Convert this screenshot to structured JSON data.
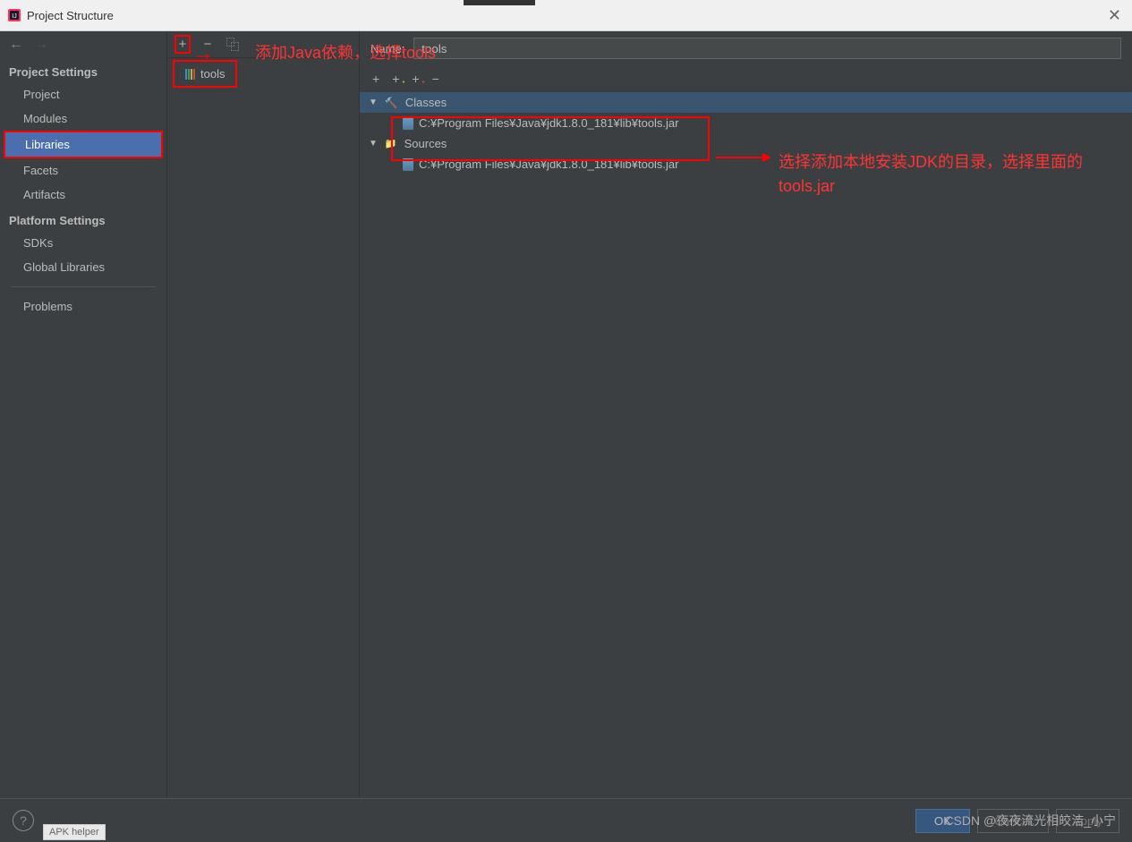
{
  "titlebar": {
    "title": "Project Structure"
  },
  "nav": {
    "back": "←",
    "forward": "→"
  },
  "sidebar": {
    "section1": "Project Settings",
    "items1": [
      "Project",
      "Modules",
      "Libraries",
      "Facets",
      "Artifacts"
    ],
    "section2": "Platform Settings",
    "items2": [
      "SDKs",
      "Global Libraries"
    ],
    "section3": "Problems"
  },
  "middle": {
    "toolbar": {
      "add": "+",
      "remove": "−",
      "copy": "⿻"
    },
    "library": "tools"
  },
  "content": {
    "name_label": "Name:",
    "name_value": "tools",
    "tree_toolbar": [
      "+",
      "+",
      "+",
      "−"
    ],
    "classes_label": "Classes",
    "classes_path": "C:¥Program Files¥Java¥jdk1.8.0_181¥lib¥tools.jar",
    "sources_label": "Sources",
    "sources_path": "C:¥Program Files¥Java¥jdk1.8.0_181¥lib¥tools.jar"
  },
  "annotations": {
    "a1": "添加Java依赖，选择tools",
    "a2": "选择添加本地安装JDK的目录，选择里面的tools.jar"
  },
  "footer": {
    "help": "?",
    "ok": "OK",
    "cancel": "Cancel",
    "apply": "Apply",
    "watermark": "CSDN @夜夜流光相皎洁_小宁",
    "apk": "APK helper"
  }
}
